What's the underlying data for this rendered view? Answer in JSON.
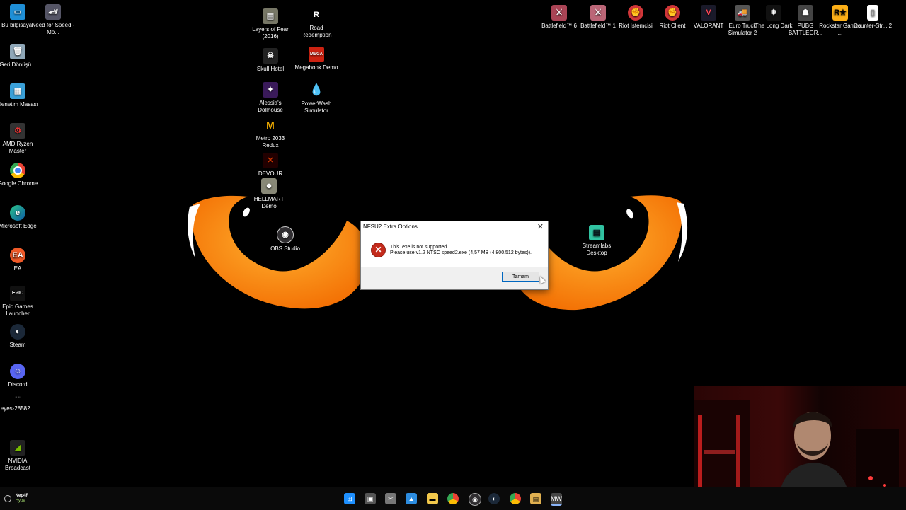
{
  "desktop_icons": {
    "col1": [
      {
        "label": "Bu bilgisayar"
      },
      {
        "label": "Geri Dönüşü..."
      },
      {
        "label": "Denetim Masası"
      },
      {
        "label": "AMD Ryzen Master"
      },
      {
        "label": "Google Chrome"
      },
      {
        "label": "Microsoft Edge"
      },
      {
        "label": "EA"
      },
      {
        "label": "Epic Games Launcher"
      },
      {
        "label": "Steam"
      },
      {
        "label": "Discord"
      },
      {
        "label": "eyes-28582..."
      },
      {
        "label": "NVIDIA Broadcast"
      }
    ],
    "col2": [
      {
        "label": "Need for Speed - Mo..."
      }
    ],
    "mid1": [
      {
        "label": "Layers of Fear (2016)"
      },
      {
        "label": "Skull Hotel"
      },
      {
        "label": "Alessia's Dollhouse"
      },
      {
        "label": "Metro 2033 Redux"
      },
      {
        "label": "DEVOUR"
      },
      {
        "label": "HELLMART Demo"
      },
      {
        "label": "OBS Studio"
      }
    ],
    "mid2": [
      {
        "label": "Road Redemption"
      },
      {
        "label": "Megabonk Demo"
      },
      {
        "label": "PowerWash Simulator"
      }
    ],
    "right_row": [
      {
        "label": "Battlefield™ 6"
      },
      {
        "label": "Battlefield™ 1"
      },
      {
        "label": "Riot İstemcisi"
      },
      {
        "label": "Riot Client"
      },
      {
        "label": "VALORANT"
      },
      {
        "label": "Euro Truck Simulator 2"
      },
      {
        "label": "The Long Dark"
      },
      {
        "label": "PUBG BATTLEGR..."
      },
      {
        "label": "Rockstar Games ..."
      },
      {
        "label": "Counter-Str... 2"
      }
    ],
    "streamlabs": {
      "label": "Streamlabs Desktop"
    }
  },
  "dialog": {
    "title": "NFSU2 Extra Options",
    "close_glyph": "✕",
    "line1": "This .exe is not supported.",
    "line2": "Please use v1.2 NTSC speed2.exe (4,57 MB (4.800.512 bytes)).",
    "ok_label": "Tamam"
  },
  "taskbar": {
    "left_title": "Nep4F",
    "left_sub": "Hype"
  },
  "colors": {
    "wallpaper_orange": "#f7941d",
    "dialog_error_red": "#c42b1c",
    "accent_blue": "#0067c0"
  }
}
